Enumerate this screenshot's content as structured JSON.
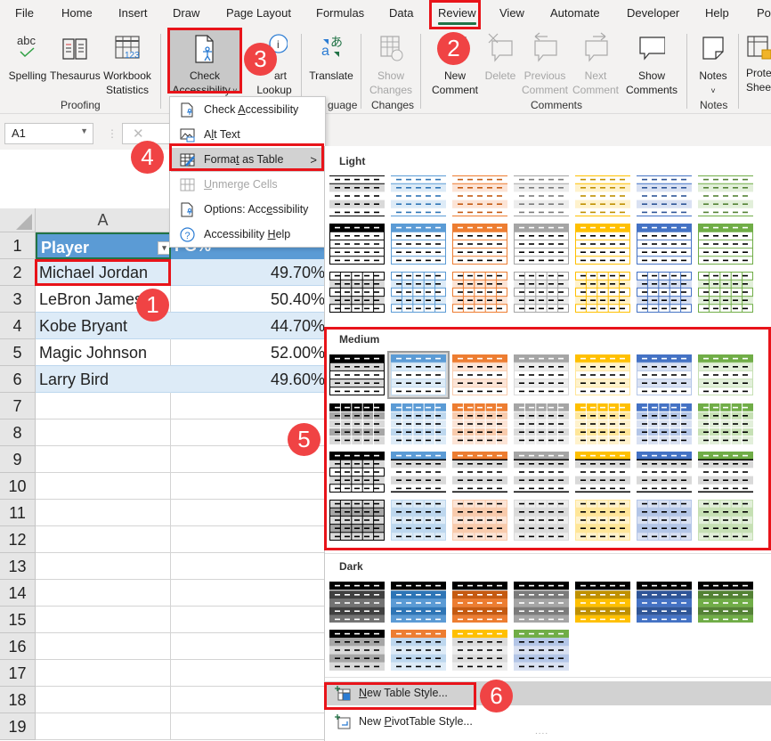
{
  "tabs": [
    {
      "label": "File"
    },
    {
      "label": "Home"
    },
    {
      "label": "Insert"
    },
    {
      "label": "Draw"
    },
    {
      "label": "Page Layout"
    },
    {
      "label": "Formulas"
    },
    {
      "label": "Data"
    },
    {
      "label": "Review",
      "active": true
    },
    {
      "label": "View"
    },
    {
      "label": "Automate"
    },
    {
      "label": "Developer"
    },
    {
      "label": "Help"
    },
    {
      "label": "Po"
    }
  ],
  "ribbon": {
    "spelling": "Spelling",
    "thesaurus": "Thesaurus",
    "workbook_l1": "Workbook",
    "workbook_l2": "Statistics",
    "check_l1": "Check",
    "check_l2": "Accessibility",
    "smart_l1": "art",
    "smart_l2": "Lookup",
    "translate": "Translate",
    "showchanges_l1": "Show",
    "showchanges_l2": "Changes",
    "newcomment_l1": "New",
    "newcomment_l2": "Comment",
    "delete": "Delete",
    "previous_l1": "Previous",
    "previous_l2": "Comment",
    "next_l1": "Next",
    "next_l2": "Comment",
    "showcomments_l1": "Show",
    "showcomments_l2": "Comments",
    "notes": "Notes",
    "protect_l1": "Prote",
    "protect_l2": "Shee",
    "groups": {
      "proofing": "Proofing",
      "language": "guage",
      "changes": "Changes",
      "comments": "Comments",
      "notes": "Notes"
    }
  },
  "formula_bar": {
    "name_box": "A1"
  },
  "sheet": {
    "column_headers": [
      "A"
    ],
    "row_numbers": [
      "1",
      "2",
      "3",
      "4",
      "5",
      "6",
      "7",
      "8",
      "9",
      "10",
      "11",
      "12",
      "13",
      "14",
      "15",
      "16",
      "17",
      "18",
      "19"
    ],
    "header": [
      "Player",
      "FG%"
    ],
    "rows": [
      [
        "Michael Jordan",
        "49.70%"
      ],
      [
        "LeBron James",
        "50.40%"
      ],
      [
        "Kobe Bryant",
        "44.70%"
      ],
      [
        "Magic Johnson",
        "52.00%"
      ],
      [
        "Larry Bird",
        "49.60%"
      ]
    ]
  },
  "menu": {
    "items": [
      {
        "pre": "Check ",
        "key": "A",
        "post": "ccessibility",
        "disabled": false
      },
      {
        "pre": "A",
        "key": "l",
        "post": "t Text",
        "disabled": false
      },
      {
        "pre": "Forma",
        "key": "t",
        "post": " as Table",
        "disabled": false,
        "submenu": ">"
      },
      {
        "pre": "",
        "key": "U",
        "post": "nmerge Cells",
        "disabled": true
      },
      {
        "pre": "Options: Acc",
        "key": "e",
        "post": "ssibility",
        "disabled": false
      },
      {
        "pre": "Accessibility ",
        "key": "H",
        "post": "elp",
        "disabled": false
      }
    ]
  },
  "gallery": {
    "sections": {
      "light": "Light",
      "medium": "Medium",
      "dark": "Dark"
    },
    "palette": {
      "black": {
        "main": "#000000",
        "light": "#d9d9d9",
        "mid": "#a6a6a6",
        "dark": "#404040",
        "dark2": "#737373"
      },
      "blue": {
        "main": "#5b9bd5",
        "light": "#ddebf7",
        "mid": "#bdd7ee",
        "dark": "#2e75b6",
        "dark2": "#5b9bd5"
      },
      "orange": {
        "main": "#ed7d31",
        "light": "#fce4d6",
        "mid": "#f8cbad",
        "dark": "#c55a11",
        "dark2": "#ed7d31"
      },
      "gray": {
        "main": "#a5a5a5",
        "light": "#ededed",
        "mid": "#dbdbdb",
        "dark": "#7b7b7b",
        "dark2": "#a5a5a5"
      },
      "gold": {
        "main": "#ffc000",
        "light": "#fff2cc",
        "mid": "#ffe699",
        "dark": "#bf9000",
        "dark2": "#ffc000"
      },
      "navy": {
        "main": "#4472c4",
        "light": "#d9e1f2",
        "mid": "#b4c6e7",
        "dark": "#2f5597",
        "dark2": "#4472c4"
      },
      "green": {
        "main": "#70ad47",
        "light": "#e2efda",
        "mid": "#c6e0b4",
        "dark": "#548235",
        "dark2": "#70ad47"
      }
    },
    "color_order": [
      "black",
      "blue",
      "orange",
      "gray",
      "gold",
      "navy",
      "green"
    ],
    "selected_style": "Medium 2",
    "new_table_style": {
      "pre": "",
      "key": "N",
      "post": "ew Table Style..."
    },
    "new_pivot_style": {
      "pre": "New ",
      "key": "P",
      "post": "ivotTable Style..."
    },
    "more": "...."
  },
  "annotations": [
    "1",
    "2",
    "3",
    "4",
    "5",
    "6"
  ]
}
